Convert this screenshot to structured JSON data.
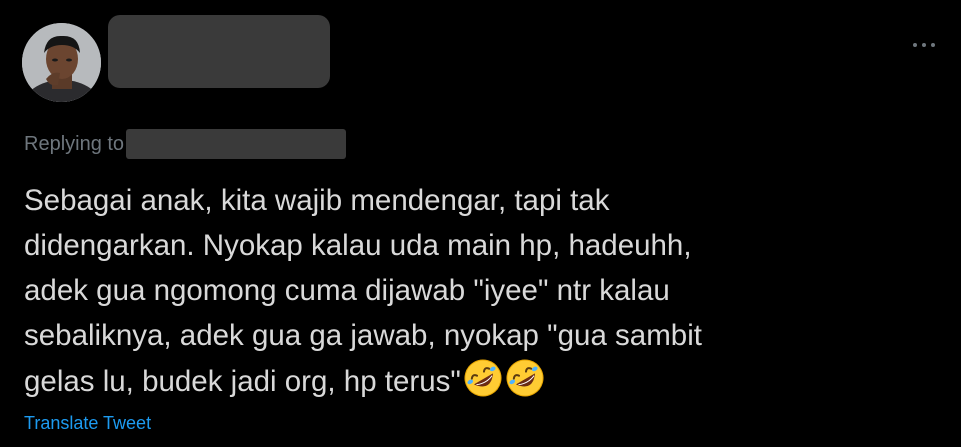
{
  "tweet": {
    "author_avatar_icon": "user-avatar-photo",
    "author_name_redacted": true,
    "more_icon": "more-horizontal-icon",
    "replying_to_label": "Replying to",
    "replying_to_handle_redacted": true,
    "text_lines": [
      "Sebagai anak, kita wajib mendengar, tapi tak",
      "didengarkan. Nyokap kalau uda main hp, hadeuhh,",
      "adek gua ngomong cuma dijawab \"iyee\" ntr kalau",
      "sebaliknya, adek gua ga jawab, nyokap \"gua sambit",
      "gelas lu, budek jadi org, hp terus\""
    ],
    "trailing_emoji": [
      "rolling-on-floor-laughing-emoji",
      "rolling-on-floor-laughing-emoji"
    ],
    "translate_label": "Translate Tweet"
  },
  "colors": {
    "background": "#000000",
    "text": "#d9d9d9",
    "muted": "#6e767d",
    "link": "#1d9bf0",
    "redaction": "#3a3a3a"
  }
}
